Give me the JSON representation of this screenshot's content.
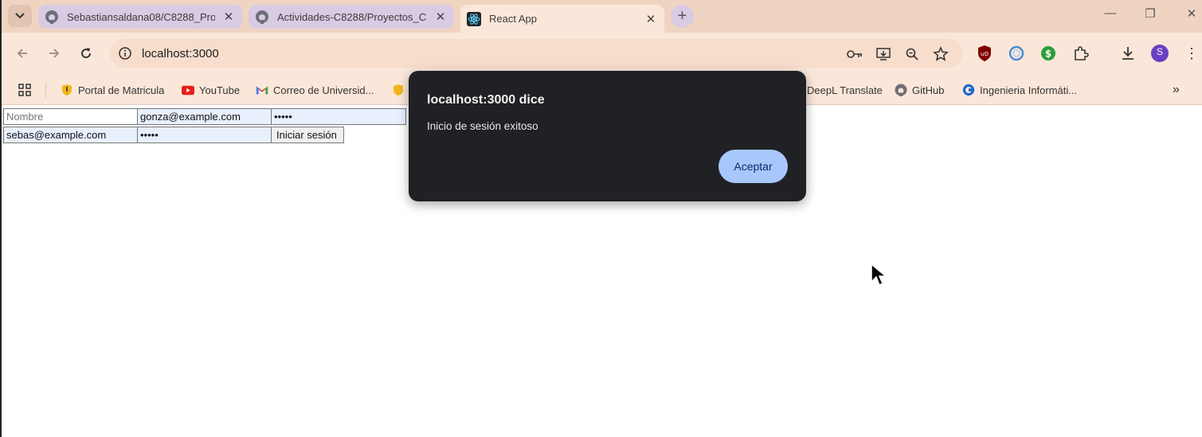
{
  "browser": {
    "tabs": [
      {
        "title": "Sebastiansaldana08/C8288_Pro",
        "favicon": "github-icon",
        "active": false
      },
      {
        "title": "Actividades-C8288/Proyectos_C",
        "favicon": "github-icon",
        "active": false
      },
      {
        "title": "React App",
        "favicon": "react-icon",
        "active": true
      }
    ],
    "address_bar": {
      "url": "localhost:3000"
    },
    "bookmarks": [
      {
        "label": "Portal de Matricula",
        "icon": "shield-icon"
      },
      {
        "label": "YouTube",
        "icon": "youtube-icon"
      },
      {
        "label": "Correo de Universid...",
        "icon": "gmail-icon"
      },
      {
        "label": "DeepL Translate",
        "icon": "deepl-icon"
      },
      {
        "label": "GitHub",
        "icon": "github-icon"
      },
      {
        "label": "Ingenieria Informáti...",
        "icon": "c-logo-icon"
      }
    ],
    "profile_initial": "S",
    "colors": {
      "frame": "#efd4c2",
      "toolbar": "#fbe7d9",
      "dialog_bg": "#202124",
      "dialog_button": "#a8c7fa"
    }
  },
  "page": {
    "register_form": {
      "name_placeholder": "Nombre",
      "email_value": "gonza@example.com",
      "password_masked": "•••••"
    },
    "login_form": {
      "email_value": "sebas@example.com",
      "password_masked": "•••••",
      "submit_label": "Iniciar sesión"
    }
  },
  "alert": {
    "title": "localhost:3000 dice",
    "message": "Inicio de sesión exitoso",
    "button_label": "Aceptar"
  }
}
